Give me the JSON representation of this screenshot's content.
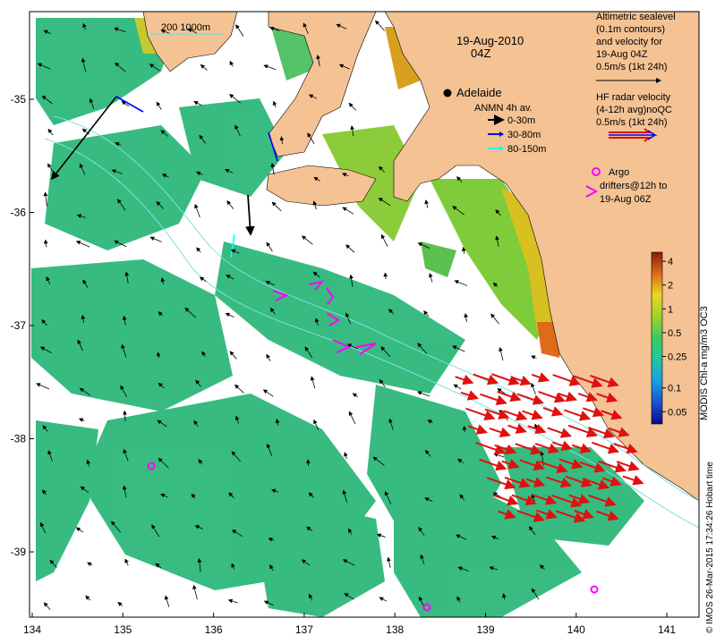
{
  "map": {
    "date_label": "19-Aug-2010",
    "time_label": "04Z",
    "scale_bar": {
      "label": "200  1000m"
    },
    "cities": [
      {
        "name": "Adelaide"
      }
    ],
    "anmn": {
      "title": "ANMN 4h av.",
      "items": [
        {
          "label": "0-30m",
          "color": "#000000"
        },
        {
          "label": "30-80m",
          "color": "#0000ff"
        },
        {
          "label": "80-150m",
          "color": "#00ffff"
        }
      ]
    },
    "altimetric_lines": [
      "Altimetric sealevel",
      "(0.1m contours)",
      "and velocity for",
      "19-Aug 04Z",
      "0.5m/s (1kt 24h)"
    ],
    "hf_radar_lines": [
      "HF radar velocity",
      "(4-12h avg)noQC",
      "0.5m/s (1kt 24h)"
    ],
    "argo_lines": [
      "Argo",
      "drifters@12h to",
      "19-Aug 06Z"
    ],
    "colorbar": {
      "title": "MODIS Chl-a mg/m3 OC3",
      "ticks": [
        "4",
        "2",
        "1",
        "0.5",
        "0.25",
        "0.1",
        "0.05"
      ]
    },
    "x_ticks": [
      "134",
      "135",
      "136",
      "137",
      "138",
      "139",
      "140",
      "141"
    ],
    "y_ticks": [
      "-35",
      "-36",
      "-37",
      "-38",
      "-39"
    ],
    "credit": "© IMOS 26-Mar-2015 17:34:26 Hobart time",
    "colors": {
      "land": "#f4c293",
      "ocean_chl": "#2db87a",
      "hf_radar": "#e01010",
      "argo": "#ff00ff"
    }
  }
}
